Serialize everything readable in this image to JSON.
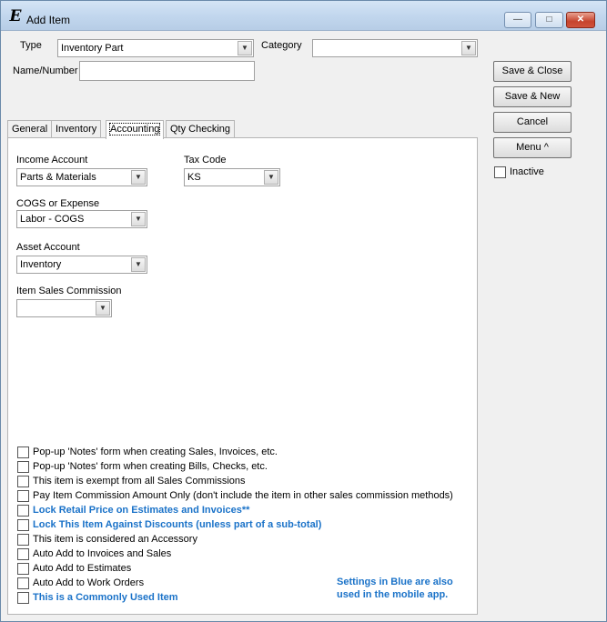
{
  "window": {
    "title": "Add Item",
    "app_icon_glyph": "E"
  },
  "header": {
    "type_label": "Type",
    "type_value": "Inventory Part",
    "category_label": "Category",
    "category_value": "",
    "name_label": "Name/Number",
    "name_value": ""
  },
  "tabs": [
    {
      "label": "General"
    },
    {
      "label": "Inventory"
    },
    {
      "label": "Accounting"
    },
    {
      "label": "Qty Checking"
    }
  ],
  "accounting": {
    "income_label": "Income Account",
    "income_value": "Parts & Materials",
    "tax_label": "Tax Code",
    "tax_value": "KS",
    "cogs_label": "COGS or Expense",
    "cogs_value": "Labor - COGS",
    "asset_label": "Asset Account",
    "asset_value": "Inventory",
    "commission_label": "Item Sales Commission",
    "commission_value": ""
  },
  "buttons": {
    "save_close": "Save & Close",
    "save_new": "Save & New",
    "cancel": "Cancel",
    "menu": "Menu ^",
    "inactive": "Inactive"
  },
  "options": [
    {
      "label": "Pop-up 'Notes' form when creating Sales, Invoices, etc.",
      "blue": false,
      "checked": false
    },
    {
      "label": "Pop-up 'Notes' form when creating Bills, Checks, etc.",
      "blue": false,
      "checked": false
    },
    {
      "label": "This item is exempt from all Sales Commissions",
      "blue": false,
      "checked": false
    },
    {
      "label": "Pay Item Commission Amount Only (don't include the item in other sales commission methods)",
      "blue": false,
      "checked": false
    },
    {
      "label": "Lock Retail Price on Estimates and Invoices**",
      "blue": true,
      "checked": false
    },
    {
      "label": "Lock This Item Against Discounts (unless part of a sub-total)",
      "blue": true,
      "checked": false
    },
    {
      "label": "This item is considered an Accessory",
      "blue": false,
      "checked": false
    },
    {
      "label": "Auto Add to Invoices and Sales",
      "blue": false,
      "checked": false
    },
    {
      "label": "Auto Add to Estimates",
      "blue": false,
      "checked": false
    },
    {
      "label": "Auto Add to Work Orders",
      "blue": false,
      "checked": false
    },
    {
      "label": "This is a Commonly Used Item",
      "blue": true,
      "checked": false
    }
  ],
  "blue_note": {
    "line1": "Settings in Blue are also",
    "line2": "used in the mobile app."
  },
  "colors": {
    "blue_text": "#1a72c8",
    "close_button": "#c6432d"
  }
}
